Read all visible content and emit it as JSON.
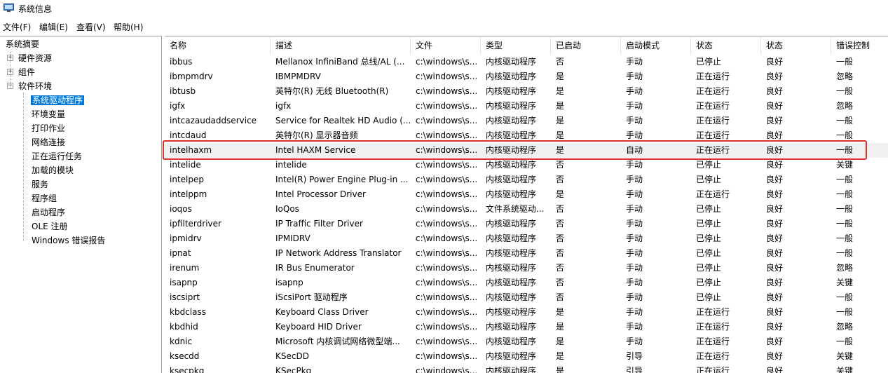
{
  "window": {
    "title": "系统信息",
    "icon": "system-info-icon"
  },
  "menu": [
    "文件(F)",
    "编辑(E)",
    "查看(V)",
    "帮助(H)"
  ],
  "tree": {
    "root": "系统摘要",
    "nodes": [
      {
        "label": "硬件资源",
        "expander": "+"
      },
      {
        "label": "组件",
        "expander": "+"
      },
      {
        "label": "软件环境",
        "expander": "−"
      }
    ],
    "children": [
      "系统驱动程序",
      "环境变量",
      "打印作业",
      "网络连接",
      "正在运行任务",
      "加载的模块",
      "服务",
      "程序组",
      "启动程序",
      "OLE 注册",
      "Windows 错误报告"
    ],
    "selected": "系统驱动程序"
  },
  "table": {
    "columns": [
      "名称",
      "描述",
      "文件",
      "类型",
      "已启动",
      "启动模式",
      "状态",
      "状态",
      "错误控制"
    ],
    "rows": [
      [
        "ibbus",
        "Mellanox InfiniBand 总线/AL (...",
        "c:\\windows\\s...",
        "内核驱动程序",
        "否",
        "手动",
        "已停止",
        "良好",
        "一般"
      ],
      [
        "ibmpmdrv",
        "IBMPMDRV",
        "c:\\windows\\s...",
        "内核驱动程序",
        "是",
        "手动",
        "正在运行",
        "良好",
        "忽略"
      ],
      [
        "ibtusb",
        "英特尔(R) 无线 Bluetooth(R)",
        "c:\\windows\\s...",
        "内核驱动程序",
        "是",
        "手动",
        "正在运行",
        "良好",
        "一般"
      ],
      [
        "igfx",
        "igfx",
        "c:\\windows\\s...",
        "内核驱动程序",
        "是",
        "手动",
        "正在运行",
        "良好",
        "忽略"
      ],
      [
        "intcazaudaddservice",
        "Service for Realtek HD Audio (...",
        "c:\\windows\\s...",
        "内核驱动程序",
        "是",
        "手动",
        "正在运行",
        "良好",
        "一般"
      ],
      [
        "intcdaud",
        "英特尔(R) 显示器音频",
        "c:\\windows\\s...",
        "内核驱动程序",
        "是",
        "手动",
        "正在运行",
        "良好",
        "一般"
      ],
      [
        "intelhaxm",
        "Intel HAXM Service",
        "c:\\windows\\s...",
        "内核驱动程序",
        "是",
        "自动",
        "正在运行",
        "良好",
        "一般"
      ],
      [
        "intelide",
        "intelide",
        "c:\\windows\\s...",
        "内核驱动程序",
        "否",
        "手动",
        "已停止",
        "良好",
        "关键"
      ],
      [
        "intelpep",
        "Intel(R) Power Engine Plug-in ...",
        "c:\\windows\\s...",
        "内核驱动程序",
        "否",
        "手动",
        "已停止",
        "良好",
        "一般"
      ],
      [
        "intelppm",
        "Intel Processor Driver",
        "c:\\windows\\s...",
        "内核驱动程序",
        "是",
        "手动",
        "正在运行",
        "良好",
        "一般"
      ],
      [
        "ioqos",
        "IoQos",
        "c:\\windows\\s...",
        "文件系统驱动...",
        "否",
        "手动",
        "已停止",
        "良好",
        "一般"
      ],
      [
        "ipfilterdriver",
        "IP Traffic Filter Driver",
        "c:\\windows\\s...",
        "内核驱动程序",
        "否",
        "手动",
        "已停止",
        "良好",
        "一般"
      ],
      [
        "ipmidrv",
        "IPMIDRV",
        "c:\\windows\\s...",
        "内核驱动程序",
        "否",
        "手动",
        "已停止",
        "良好",
        "一般"
      ],
      [
        "ipnat",
        "IP Network Address Translator",
        "c:\\windows\\s...",
        "内核驱动程序",
        "否",
        "手动",
        "已停止",
        "良好",
        "一般"
      ],
      [
        "irenum",
        "IR Bus Enumerator",
        "c:\\windows\\s...",
        "内核驱动程序",
        "否",
        "手动",
        "已停止",
        "良好",
        "忽略"
      ],
      [
        "isapnp",
        "isapnp",
        "c:\\windows\\s...",
        "内核驱动程序",
        "否",
        "手动",
        "已停止",
        "良好",
        "关键"
      ],
      [
        "iscsiprt",
        "iScsiPort 驱动程序",
        "c:\\windows\\s...",
        "内核驱动程序",
        "否",
        "手动",
        "已停止",
        "良好",
        "一般"
      ],
      [
        "kbdclass",
        "Keyboard Class Driver",
        "c:\\windows\\s...",
        "内核驱动程序",
        "是",
        "手动",
        "正在运行",
        "良好",
        "一般"
      ],
      [
        "kbdhid",
        "Keyboard HID Driver",
        "c:\\windows\\s...",
        "内核驱动程序",
        "是",
        "手动",
        "正在运行",
        "良好",
        "忽略"
      ],
      [
        "kdnic",
        "Microsoft 内核调试网络微型端...",
        "c:\\windows\\s...",
        "内核驱动程序",
        "是",
        "手动",
        "正在运行",
        "良好",
        "一般"
      ],
      [
        "ksecdd",
        "KSecDD",
        "c:\\windows\\s...",
        "内核驱动程序",
        "是",
        "引导",
        "正在运行",
        "良好",
        "关键"
      ],
      [
        "ksecpkg",
        "KSecPkg",
        "c:\\windows\\s...",
        "内核驱动程序",
        "是",
        "引导",
        "正在运行",
        "良好",
        "关键"
      ]
    ],
    "highlighted_row": "intelhaxm"
  },
  "colors": {
    "selection": "#0078d7",
    "callout": "#e0302a",
    "highlight_row": "#f0f0f0"
  }
}
